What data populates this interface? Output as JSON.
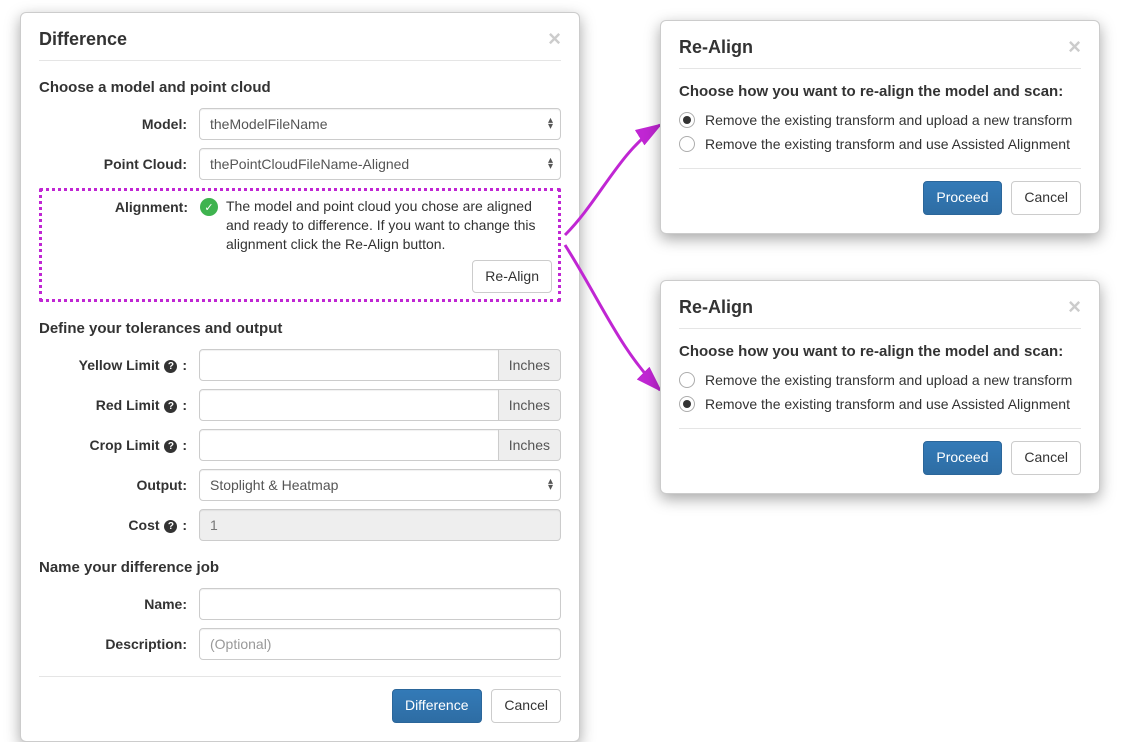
{
  "main": {
    "title": "Difference",
    "section_choose": "Choose a model and point cloud",
    "model_label": "Model:",
    "model_value": "theModelFileName",
    "pc_label": "Point Cloud:",
    "pc_value": "thePointCloudFileName-Aligned",
    "alignment_label": "Alignment:",
    "alignment_text": "The model and point cloud you chose are aligned and ready to difference. If you want to change this alignment click the Re-Align button.",
    "realign_btn": "Re-Align",
    "section_tol": "Define your tolerances and output",
    "yellow_label": "Yellow Limit",
    "red_label": "Red Limit",
    "crop_label": "Crop Limit",
    "unit": "Inches",
    "output_label": "Output:",
    "output_value": "Stoplight & Heatmap",
    "cost_label": "Cost",
    "cost_value": "1",
    "section_name": "Name your difference job",
    "name_label": "Name:",
    "desc_label": "Description:",
    "desc_placeholder": "(Optional)",
    "btn_primary": "Difference",
    "btn_cancel": "Cancel"
  },
  "realign": {
    "title": "Re-Align",
    "heading": "Choose how you want to re-align the model and scan:",
    "opt1": "Remove the existing transform and upload a new transform",
    "opt2": "Remove the existing transform and use Assisted Alignment",
    "btn_proceed": "Proceed",
    "btn_cancel": "Cancel"
  }
}
